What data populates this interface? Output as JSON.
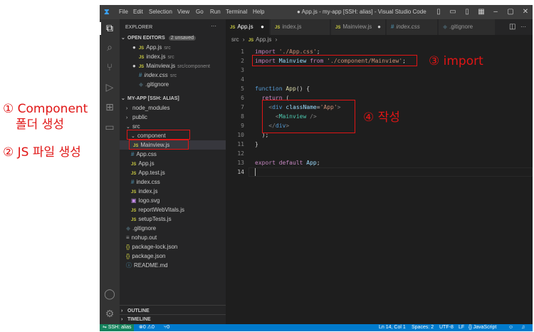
{
  "annotations": {
    "step1_line1": "① Component",
    "step1_line2": "폴더 생성",
    "step2": "② JS 파일 생성",
    "step3": "③ import",
    "step4": "④ 작성"
  },
  "titlebar": {
    "menu": [
      "File",
      "Edit",
      "Selection",
      "View",
      "Go",
      "Run",
      "Terminal",
      "Help"
    ],
    "title": "● App.js - my-app [SSH: alias] - Visual Studio Code"
  },
  "activity": [
    "files-icon",
    "search-icon",
    "source-control-icon",
    "run-debug-icon",
    "extensions-icon",
    "remote-explorer-icon",
    "account-icon",
    "settings-icon"
  ],
  "sidebar": {
    "header": "EXPLORER",
    "open_editors": "OPEN EDITORS",
    "unsaved_badge": "2 unsaved",
    "open_items": [
      {
        "name": "App.js",
        "path": "src",
        "type": "js",
        "modified": true
      },
      {
        "name": "index.js",
        "path": "src",
        "type": "js",
        "modified": false
      },
      {
        "name": "Mainview.js",
        "path": "src/component",
        "type": "js",
        "modified": true
      },
      {
        "name": "index.css",
        "path": "src",
        "type": "css",
        "modified": false
      },
      {
        "name": ".gitignore",
        "path": "",
        "type": "git",
        "modified": false
      }
    ],
    "project": "MY-APP [SSH: ALIAS]",
    "tree": [
      {
        "name": "node_modules",
        "type": "folder",
        "indent": 1
      },
      {
        "name": "public",
        "type": "folder",
        "indent": 1
      },
      {
        "name": "src",
        "type": "folder-open",
        "indent": 1
      },
      {
        "name": "component",
        "type": "folder-open",
        "indent": 2
      },
      {
        "name": "Mainview.js",
        "type": "js",
        "indent": 3
      },
      {
        "name": "App.css",
        "type": "css",
        "indent": 2
      },
      {
        "name": "App.js",
        "type": "js",
        "indent": 2
      },
      {
        "name": "App.test.js",
        "type": "js",
        "indent": 2
      },
      {
        "name": "index.css",
        "type": "css",
        "indent": 2
      },
      {
        "name": "index.js",
        "type": "js",
        "indent": 2
      },
      {
        "name": "logo.svg",
        "type": "svg",
        "indent": 2
      },
      {
        "name": "reportWebVitals.js",
        "type": "js",
        "indent": 2
      },
      {
        "name": "setupTests.js",
        "type": "js",
        "indent": 2
      },
      {
        "name": ".gitignore",
        "type": "git",
        "indent": 1
      },
      {
        "name": "nohup.out",
        "type": "file",
        "indent": 1
      },
      {
        "name": "package-lock.json",
        "type": "json",
        "indent": 1
      },
      {
        "name": "package.json",
        "type": "json",
        "indent": 1
      },
      {
        "name": "README.md",
        "type": "md",
        "indent": 1
      }
    ],
    "outline": "OUTLINE",
    "timeline": "TIMELINE"
  },
  "tabs": [
    {
      "label": "App.js",
      "type": "js",
      "active": true,
      "modified": true
    },
    {
      "label": "index.js",
      "type": "js",
      "active": false,
      "modified": false
    },
    {
      "label": "Mainview.js",
      "type": "js",
      "active": false,
      "modified": true
    },
    {
      "label": "index.css",
      "type": "css",
      "active": false,
      "modified": false
    },
    {
      "label": ".gitignore",
      "type": "git",
      "active": false,
      "modified": false
    }
  ],
  "breadcrumb": [
    "src",
    "App.js"
  ],
  "code": {
    "line_numbers": [
      "1",
      "2",
      "3",
      "4",
      "5",
      "6",
      "7",
      "8",
      "9",
      "10",
      "11",
      "12",
      "13",
      "14"
    ],
    "l1_kw": "import",
    "l1_str": "'./App.css'",
    "l1_end": ";",
    "l2_kw": "import",
    "l2_ident": "Mainview",
    "l2_from": "from",
    "l2_str": "'./component/Mainview'",
    "l2_end": ";",
    "l4_kw": "function",
    "l4_fn": "App",
    "l4_rest": "() {",
    "l5_kw": "return",
    "l5_rest": "(",
    "l6_open": "<",
    "l6_tag": "div",
    "l6_attr": "className",
    "l6_eq": "=",
    "l6_str": "'App'",
    "l6_close": ">",
    "l7_open": "<",
    "l7_cmp": "Mainview",
    "l7_close": " />",
    "l8_open": "</",
    "l8_tag": "div",
    "l8_close": ">",
    "l9": ");",
    "l10": "}",
    "l12_kw": "export",
    "l12_kw2": "default",
    "l12_ident": "App",
    "l12_end": ";"
  },
  "statusbar": {
    "remote": "SSH: alias",
    "problems": "⊗0 ⚠0",
    "ports": "⑂0",
    "position": "Ln 14, Col 1",
    "spaces": "Spaces: 2",
    "encoding": "UTF-8",
    "eol": "LF",
    "language": "{} JavaScript"
  }
}
